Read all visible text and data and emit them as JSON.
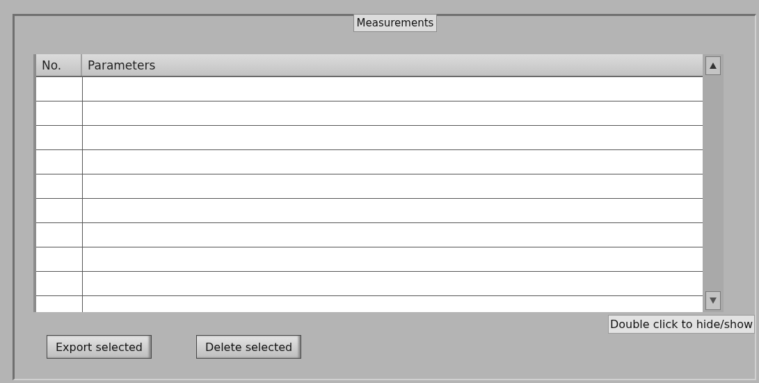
{
  "title": "Measurements",
  "table": {
    "columns": [
      "No.",
      "Parameters"
    ]
  },
  "hint": "Double click to hide/show",
  "buttons": [
    "Export selected",
    "Delete selected"
  ]
}
